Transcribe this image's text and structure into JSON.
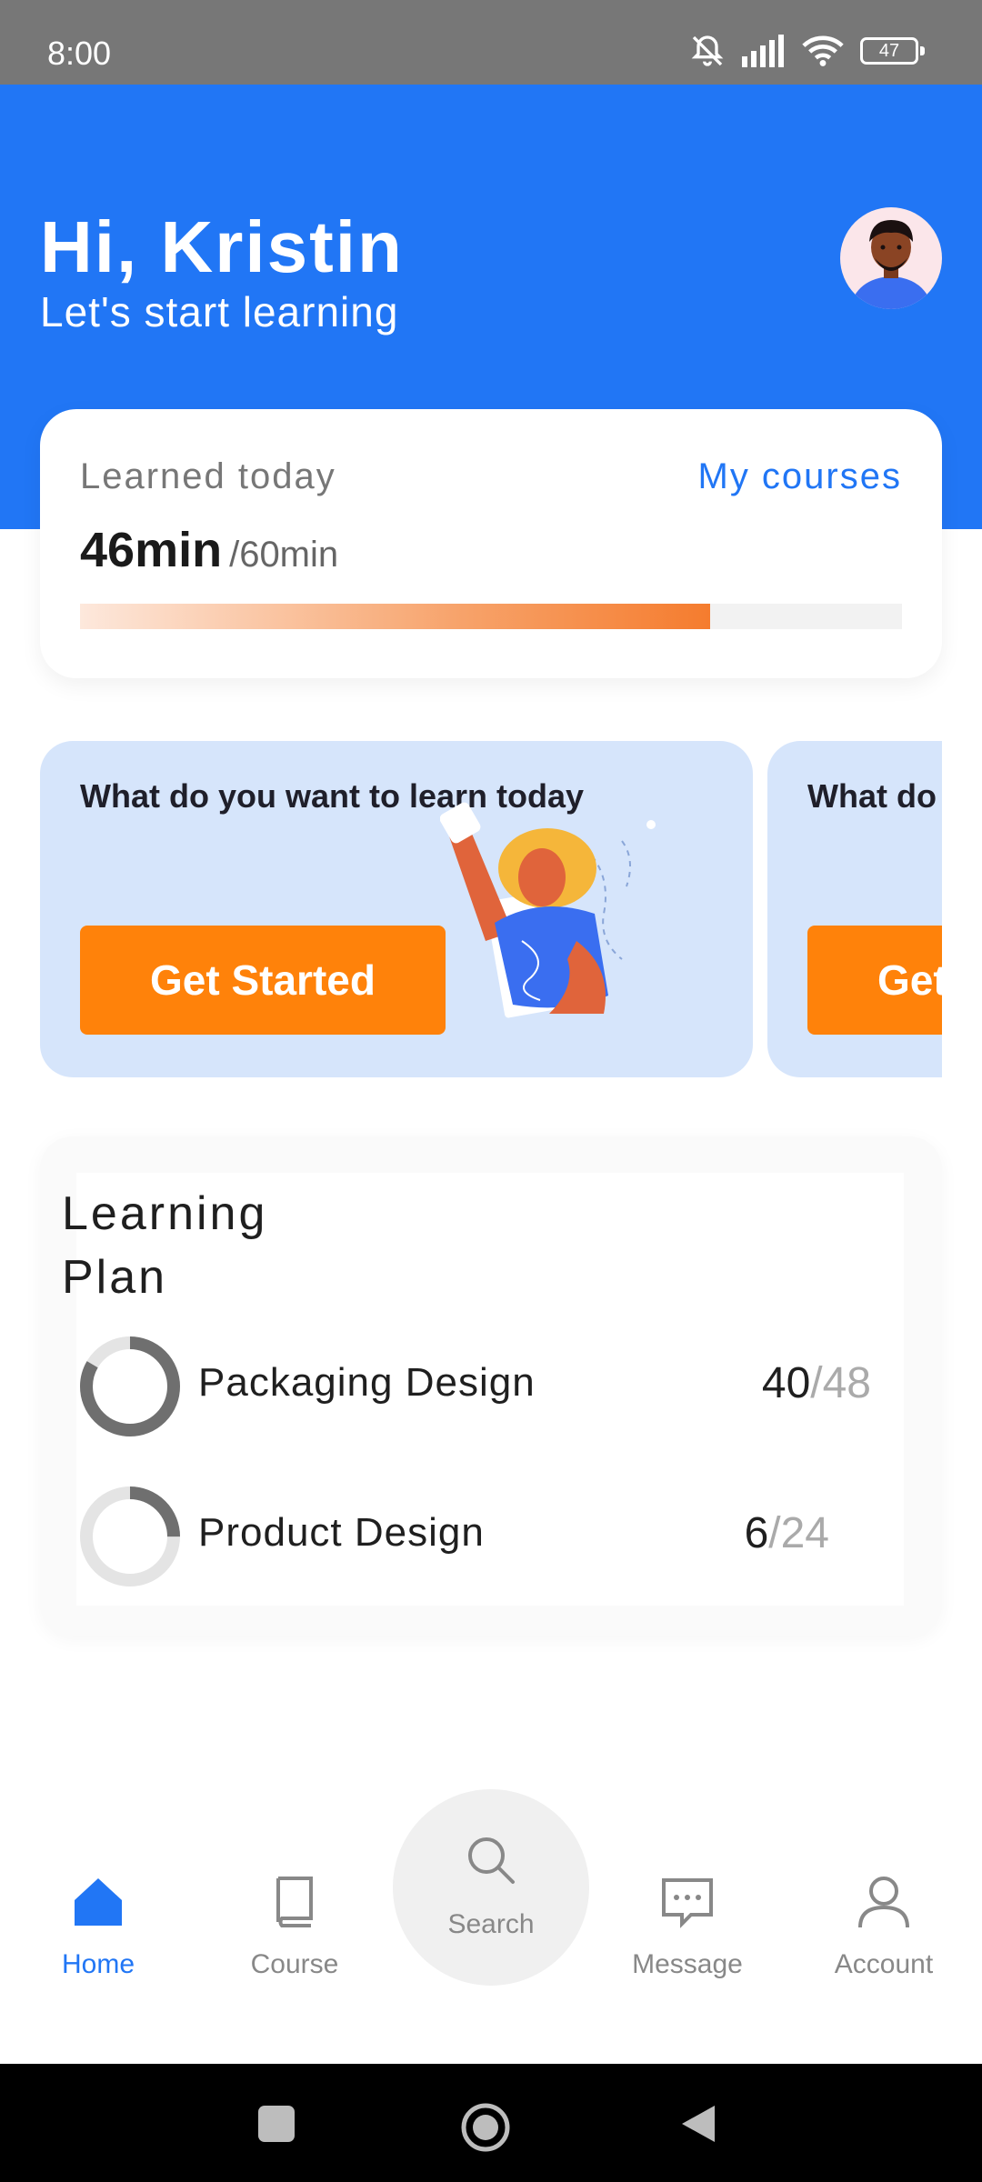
{
  "status_bar": {
    "time": "8:00",
    "battery": "47"
  },
  "header": {
    "greeting": "Hi, Kristin",
    "subtitle": "Let's start learning"
  },
  "progress": {
    "label": "Learned today",
    "link": "My courses",
    "value": "46min",
    "total": "/60min",
    "fraction": 0.7667
  },
  "promos": [
    {
      "title": "What do you want to learn today",
      "button": "Get Started"
    },
    {
      "title": "What do you want to learn today",
      "button": "Get Started"
    }
  ],
  "plan": {
    "title": "Learning Plan",
    "items": [
      {
        "name": "Packaging Design",
        "done": "40",
        "total": "/48",
        "fraction": 0.8333
      },
      {
        "name": "Product Design",
        "done": "6",
        "total": "/24",
        "fraction": 0.25
      }
    ]
  },
  "nav": {
    "home": "Home",
    "course": "Course",
    "search": "Search",
    "message": "Message",
    "account": "Account"
  },
  "colors": {
    "primary": "#2176f5",
    "accent": "#ff820a",
    "promo_bg": "#d6e5fb"
  }
}
